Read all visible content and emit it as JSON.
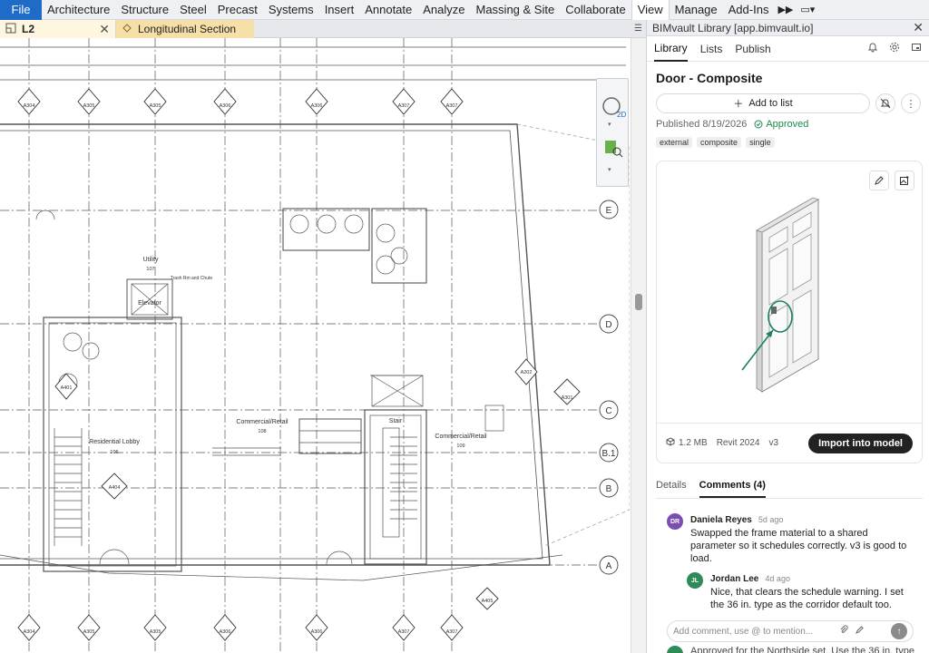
{
  "ribbon": {
    "file": "File",
    "tabs": [
      "Architecture",
      "Structure",
      "Steel",
      "Precast",
      "Systems",
      "Insert",
      "Annotate",
      "Analyze",
      "Massing & Site",
      "Collaborate",
      "View",
      "Manage",
      "Add-Ins"
    ],
    "active": "View"
  },
  "doctabs": {
    "tab1": "L2",
    "tab2": "Longitudinal Section"
  },
  "drawing": {
    "grid_labels": [
      "E",
      "D",
      "C",
      "B.1",
      "B",
      "A"
    ],
    "section_tags": [
      "A304",
      "A305",
      "A305",
      "A306",
      "A306",
      "A307",
      "A307",
      "A202",
      "A301",
      "A401",
      "A404",
      "A405",
      "A304",
      "A305",
      "A305",
      "A306",
      "A306",
      "A307",
      "A307"
    ],
    "rooms": {
      "utility": "Utility",
      "utility_no": "107",
      "elevator": "Elevator",
      "lobby": "Residential Lobby",
      "lobby_no": "106",
      "commercial1": "Commercial/Retail",
      "commercial1_no": "108",
      "commercial2": "Commercial/Retail",
      "commercial2_no": "109",
      "stair": "Stair",
      "trash": "Trash Rm and Chute"
    }
  },
  "panel": {
    "title": "BIMvault Library [app.bimvault.io]",
    "tabs": [
      "Library",
      "Lists",
      "Publish"
    ],
    "active_tab": "Library",
    "heading": "Door - Composite",
    "add_to_list": "Add to list",
    "published": "Published 8/19/2026",
    "status": "Approved",
    "tags": [
      "external",
      "composite",
      "single"
    ],
    "file_size": "1.2 MB",
    "revit": "Revit 2024",
    "version": "v3",
    "import": "Import into model",
    "detail_tabs": [
      "Details",
      "Comments (4)"
    ],
    "active_detail": "Comments (4)",
    "comments": [
      {
        "initials": "DR",
        "name": "Daniela Reyes",
        "time": "5d ago",
        "text": "Swapped the frame material to a shared parameter so it schedules correctly. v3 is good to load.",
        "color": "#7b4fb0"
      },
      {
        "initials": "JL",
        "name": "Jordan Lee",
        "time": "4d ago",
        "text": "Nice, that clears the schedule warning. I set the 36 in. type as the corridor default too.",
        "color": "#2f8b55"
      }
    ],
    "input_placeholder": "Add comment, use @ to mention...",
    "behind_text": "Approved for the Northside set. Use the 36 in. type"
  },
  "colors": {
    "accent": "#1e6cc8",
    "approved": "#1e8a4a",
    "annotation_arrow": "#1a7f66"
  }
}
